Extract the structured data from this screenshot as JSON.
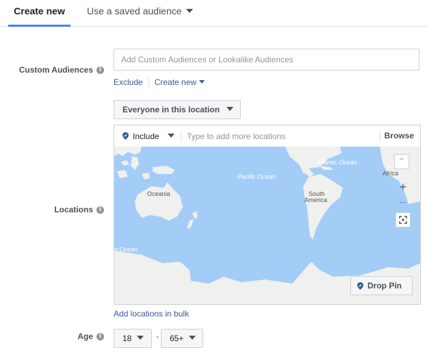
{
  "tabs": {
    "create_new": "Create new",
    "saved_audience": "Use a saved audience"
  },
  "custom_audiences": {
    "label": "Custom Audiences",
    "placeholder": "Add Custom Audiences or Lookalike Audiences",
    "exclude": "Exclude",
    "create_new": "Create new"
  },
  "locations": {
    "label": "Locations",
    "scope_button": "Everyone in this location",
    "include": "Include",
    "search_placeholder": "Type to add more locations",
    "browse": "Browse",
    "map_labels": {
      "atlantic": "Atlantic Ocean",
      "pacific": "Pacific Ocean",
      "oceania": "Oceania",
      "south_america_1": "South",
      "south_america_2": "America",
      "africa": "Africa",
      "indian": "n Ocean"
    },
    "zoom_in": "+",
    "zoom_out": "−",
    "drop_pin": "Drop Pin",
    "bulk_link": "Add locations in bulk"
  },
  "age": {
    "label": "Age",
    "min": "18",
    "separator": "-",
    "max": "65+"
  },
  "colors": {
    "accent": "#4080ff",
    "link": "#365899",
    "ocean": "#a3cdf7",
    "land": "#f0f0ee"
  },
  "icons": {
    "info": "info-icon",
    "pin": "map-pin-icon",
    "caret": "caret-down-icon",
    "fullscreen": "fullscreen-icon"
  }
}
